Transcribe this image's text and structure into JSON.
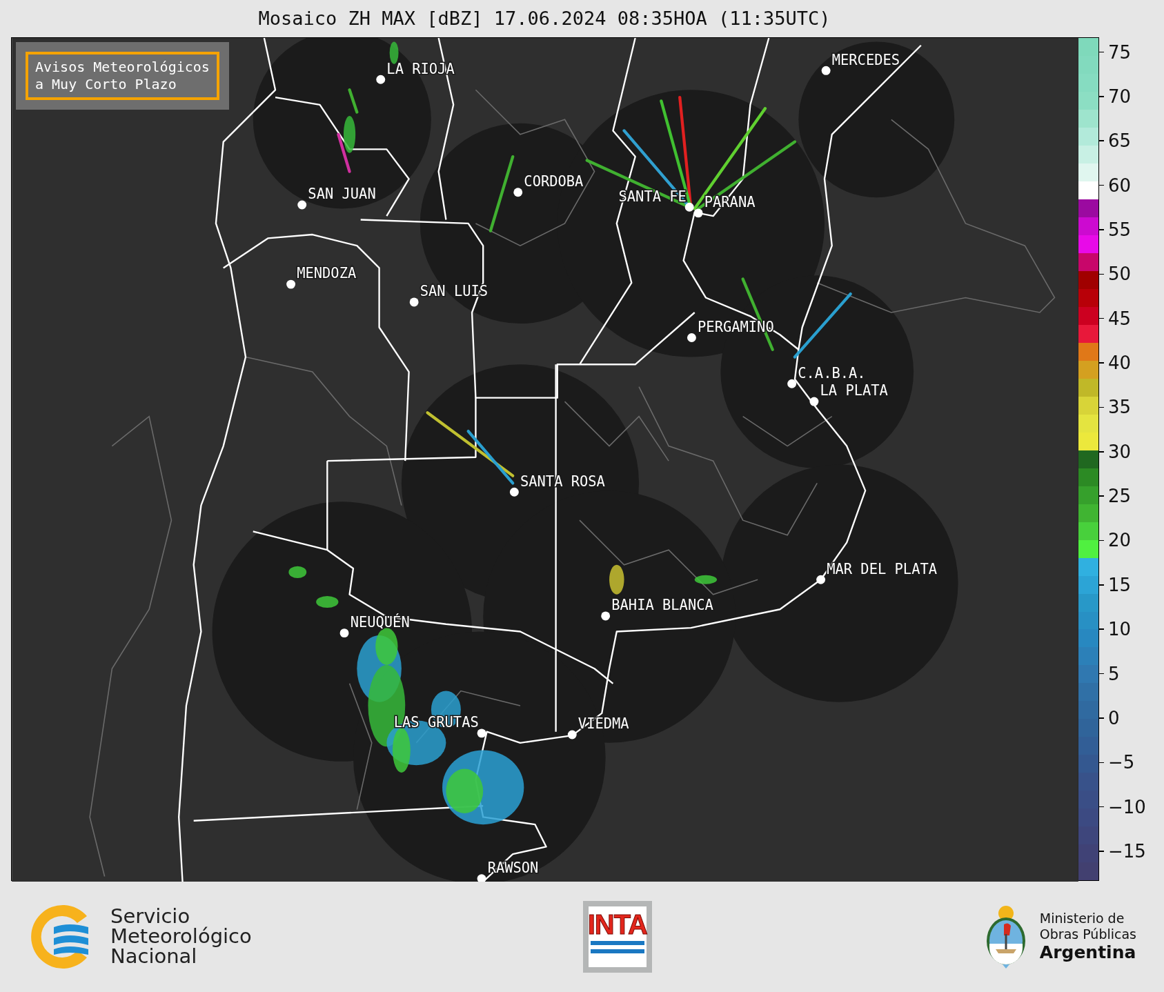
{
  "title": "Mosaico ZH MAX [dBZ] 17.06.2024 08:35HOA (11:35UTC)",
  "notice_box": {
    "text": "Avisos Meteorológicos\na Muy Corto Plazo"
  },
  "map": {
    "cities": [
      {
        "name": "LA RIOJA"
      },
      {
        "name": "MERCEDES"
      },
      {
        "name": "SAN JUAN"
      },
      {
        "name": "CORDOBA"
      },
      {
        "name": "SANTA FE"
      },
      {
        "name": "PARANA"
      },
      {
        "name": "MENDOZA"
      },
      {
        "name": "SAN LUIS"
      },
      {
        "name": "PERGAMINO"
      },
      {
        "name": "C.A.B.A."
      },
      {
        "name": "LA PLATA"
      },
      {
        "name": "SANTA ROSA"
      },
      {
        "name": "MAR DEL PLATA"
      },
      {
        "name": "BAHIA BLANCA"
      },
      {
        "name": "NEUQUÉN"
      },
      {
        "name": "LAS GRUTAS"
      },
      {
        "name": "VIEDMA"
      },
      {
        "name": "RAWSON"
      }
    ]
  },
  "colorbar": {
    "segments": [
      {
        "color": "#7fd9bb"
      },
      {
        "color": "#82dabe"
      },
      {
        "color": "#86dcc1"
      },
      {
        "color": "#8cdec3"
      },
      {
        "color": "#9ee4cd"
      },
      {
        "color": "#b2eada"
      },
      {
        "color": "#c8f0e4"
      },
      {
        "color": "#e0f6ef"
      },
      {
        "color": "#ffffff"
      },
      {
        "color": "#9b0aa0"
      },
      {
        "color": "#cc0ad0"
      },
      {
        "color": "#e80ae8"
      },
      {
        "color": "#c8066a"
      },
      {
        "color": "#a00000"
      },
      {
        "color": "#b80008"
      },
      {
        "color": "#cc0020"
      },
      {
        "color": "#e8183a"
      },
      {
        "color": "#e07818"
      },
      {
        "color": "#d4a020"
      },
      {
        "color": "#c0b828"
      },
      {
        "color": "#d8d438"
      },
      {
        "color": "#e4e440"
      },
      {
        "color": "#ece83c"
      },
      {
        "color": "#206820"
      },
      {
        "color": "#2c8a24"
      },
      {
        "color": "#36a02c"
      },
      {
        "color": "#40b432"
      },
      {
        "color": "#48d03c"
      },
      {
        "color": "#50f040"
      },
      {
        "color": "#30b0e0"
      },
      {
        "color": "#2ca4d6"
      },
      {
        "color": "#2898c8"
      },
      {
        "color": "#2890c4"
      },
      {
        "color": "#2888c0"
      },
      {
        "color": "#2c80b8"
      },
      {
        "color": "#3078b0"
      },
      {
        "color": "#3070a6"
      },
      {
        "color": "#306aa0"
      },
      {
        "color": "#30649a"
      },
      {
        "color": "#325e96"
      },
      {
        "color": "#345890"
      },
      {
        "color": "#38528a"
      },
      {
        "color": "#3a4e86"
      },
      {
        "color": "#3c4a82"
      },
      {
        "color": "#3e467c"
      },
      {
        "color": "#404276"
      },
      {
        "color": "#424070"
      }
    ],
    "ticks": [
      "75",
      "70",
      "65",
      "60",
      "55",
      "50",
      "45",
      "40",
      "35",
      "30",
      "25",
      "20",
      "15",
      "10",
      "5",
      "0",
      "−5",
      "−10",
      "−15"
    ]
  },
  "footer": {
    "logos": [
      {
        "kind": "smn",
        "text": "Servicio\nMeteorológico\nNacional"
      },
      {
        "kind": "inta",
        "text": "INTA"
      },
      {
        "kind": "ministry",
        "text": "Ministerio de\nObras Públicas",
        "emphasis": "Argentina"
      }
    ]
  }
}
